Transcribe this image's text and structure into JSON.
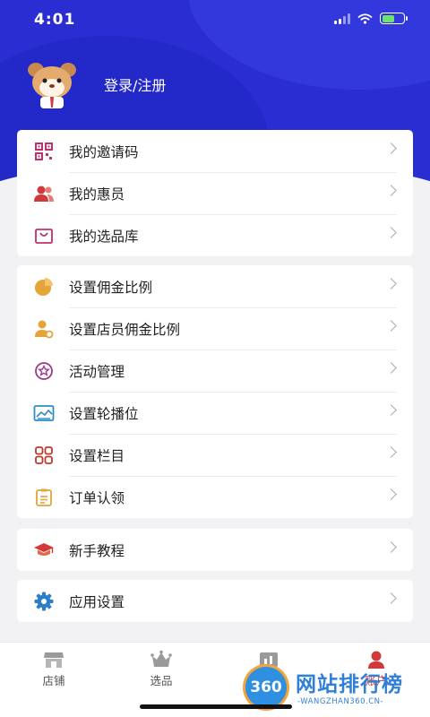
{
  "status_bar": {
    "time": "4:01"
  },
  "profile": {
    "login_label": "登录/注册"
  },
  "groups": [
    {
      "items": [
        {
          "label": "我的邀请码",
          "icon": "qr-code-icon"
        },
        {
          "label": "我的惠员",
          "icon": "users-icon"
        },
        {
          "label": "我的选品库",
          "icon": "shopping-bag-icon"
        }
      ]
    },
    {
      "items": [
        {
          "label": "设置佣金比例",
          "icon": "pie-chart-icon"
        },
        {
          "label": "设置店员佣金比例",
          "icon": "user-settings-icon"
        },
        {
          "label": "活动管理",
          "icon": "star-badge-icon"
        },
        {
          "label": "设置轮播位",
          "icon": "image-carousel-icon"
        },
        {
          "label": "设置栏目",
          "icon": "grid-icon"
        },
        {
          "label": "订单认领",
          "icon": "clipboard-icon"
        }
      ]
    },
    {
      "items": [
        {
          "label": "新手教程",
          "icon": "graduation-cap-icon"
        }
      ]
    },
    {
      "items": [
        {
          "label": "应用设置",
          "icon": "gear-icon"
        }
      ]
    }
  ],
  "tabbar": {
    "tabs": [
      {
        "label": "店铺",
        "icon": "store-icon"
      },
      {
        "label": "选品",
        "icon": "crown-icon"
      },
      {
        "label": "",
        "icon": "chart-icon"
      },
      {
        "label": "账户",
        "icon": "account-icon"
      }
    ]
  },
  "watermark": {
    "badge": "360",
    "title": "网站排行榜",
    "subtitle": "-WANGZHAN360.CN-"
  },
  "colors": {
    "header": "#2a2ed2",
    "accent": "#d03a3a",
    "watermark": "#2f7fd8"
  }
}
